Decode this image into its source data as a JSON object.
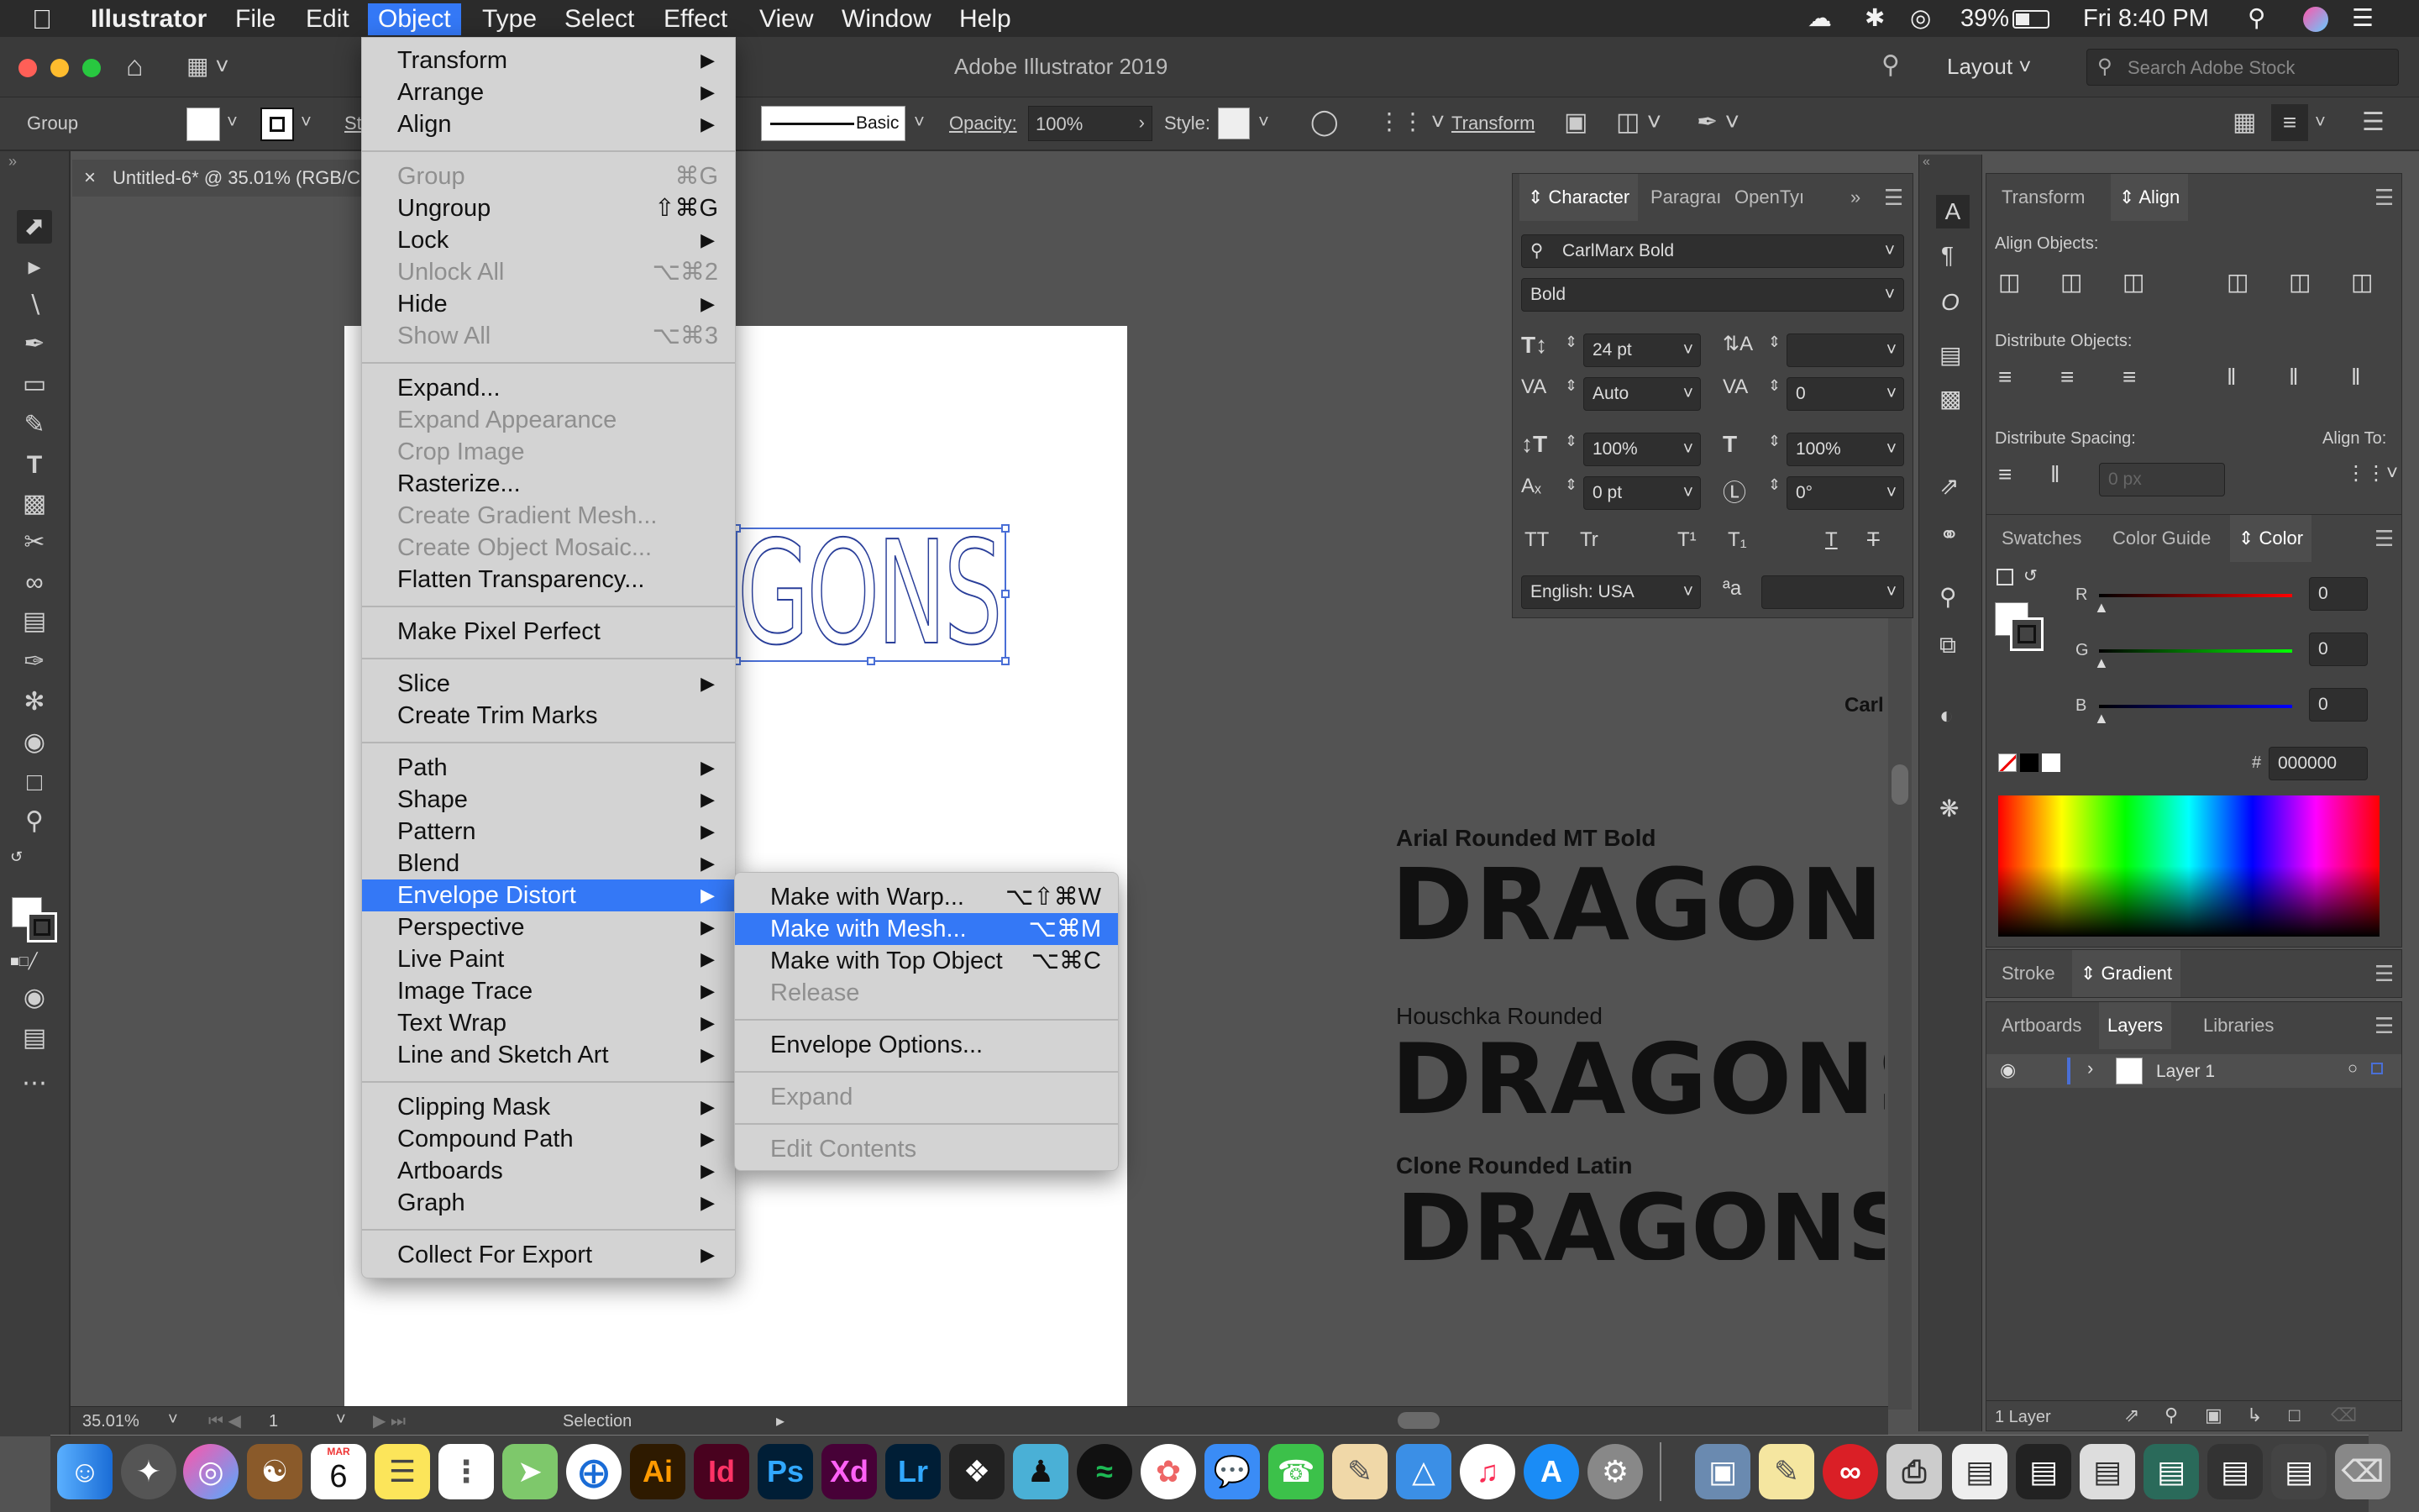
{
  "menubar": {
    "app": "Illustrator",
    "items": [
      "File",
      "Edit",
      "Object",
      "Type",
      "Select",
      "Effect",
      "View",
      "Window",
      "Help"
    ],
    "battery": "39%",
    "clock": "Fri 8:40 PM"
  },
  "titlebar": {
    "title": "Adobe Illustrator 2019",
    "workspace": "Layout",
    "search_placeholder": "Search Adobe Stock"
  },
  "controlbar": {
    "selection": "Group",
    "stroke_label": "St",
    "brush": "Basic",
    "opacity_label": "Opacity:",
    "opacity_value": "100%",
    "style_label": "Style:",
    "transform_label": "Transform"
  },
  "document": {
    "tab_title": "Untitled-6* @ 35.01% (RGB/C",
    "zoom": "35.01%",
    "artboard_num": "1",
    "status": "Selection"
  },
  "object_menu": {
    "items": [
      {
        "label": "Transform",
        "submenu": true
      },
      {
        "label": "Arrange",
        "submenu": true
      },
      {
        "label": "Align",
        "submenu": true
      },
      {
        "label": "Group",
        "shortcut": "⌘G",
        "disabled": true
      },
      {
        "label": "Ungroup",
        "shortcut": "⇧⌘G"
      },
      {
        "label": "Lock",
        "submenu": true
      },
      {
        "label": "Unlock All",
        "shortcut": "⌥⌘2",
        "disabled": true
      },
      {
        "label": "Hide",
        "submenu": true
      },
      {
        "label": "Show All",
        "shortcut": "⌥⌘3",
        "disabled": true
      },
      {
        "label": "Expand..."
      },
      {
        "label": "Expand Appearance",
        "disabled": true
      },
      {
        "label": "Crop Image",
        "disabled": true
      },
      {
        "label": "Rasterize..."
      },
      {
        "label": "Create Gradient Mesh...",
        "disabled": true
      },
      {
        "label": "Create Object Mosaic...",
        "disabled": true
      },
      {
        "label": "Flatten Transparency..."
      },
      {
        "label": "Make Pixel Perfect"
      },
      {
        "label": "Slice",
        "submenu": true
      },
      {
        "label": "Create Trim Marks"
      },
      {
        "label": "Path",
        "submenu": true
      },
      {
        "label": "Shape",
        "submenu": true
      },
      {
        "label": "Pattern",
        "submenu": true
      },
      {
        "label": "Blend",
        "submenu": true
      },
      {
        "label": "Envelope Distort",
        "submenu": true,
        "highlight": true
      },
      {
        "label": "Perspective",
        "submenu": true
      },
      {
        "label": "Live Paint",
        "submenu": true
      },
      {
        "label": "Image Trace",
        "submenu": true
      },
      {
        "label": "Text Wrap",
        "submenu": true
      },
      {
        "label": "Line and Sketch Art",
        "submenu": true
      },
      {
        "label": "Clipping Mask",
        "submenu": true
      },
      {
        "label": "Compound Path",
        "submenu": true
      },
      {
        "label": "Artboards",
        "submenu": true
      },
      {
        "label": "Graph",
        "submenu": true
      },
      {
        "label": "Collect For Export",
        "submenu": true
      }
    ]
  },
  "envelope_menu": {
    "items": [
      {
        "label": "Make with Warp...",
        "shortcut": "⌥⇧⌘W"
      },
      {
        "label": "Make with Mesh...",
        "shortcut": "⌥⌘M",
        "highlight": true
      },
      {
        "label": "Make with Top Object",
        "shortcut": "⌥⌘C"
      },
      {
        "label": "Release",
        "disabled": true
      },
      {
        "label": "Envelope Options..."
      },
      {
        "label": "Expand",
        "disabled": true
      },
      {
        "label": "Edit Contents",
        "disabled": true
      }
    ]
  },
  "canvas": {
    "selected_text": "GONS",
    "clipped_label": "CarlM",
    "samples": [
      {
        "font": "Arial Rounded MT Bold",
        "word": "DRAGONS"
      },
      {
        "font": "Houschka Rounded",
        "word": "DRAGONS"
      },
      {
        "font": "Clone Rounded Latin",
        "word": "DRAGONS"
      }
    ]
  },
  "character_panel": {
    "tabs": [
      "Character",
      "Paragraı",
      "OpenTyı"
    ],
    "font_family": "CarlMarx Bold",
    "font_style": "Bold",
    "size": "24 pt",
    "leading": "",
    "kerning": "Auto",
    "tracking": "0",
    "vscale": "100%",
    "hscale": "100%",
    "baseline": "0 pt",
    "rotation": "0°",
    "language": "English: USA"
  },
  "align_panel": {
    "tabs": [
      "Transform",
      "Align"
    ],
    "align_objects": "Align Objects:",
    "distribute_objects": "Distribute Objects:",
    "distribute_spacing": "Distribute Spacing:",
    "spacing_value": "0 px",
    "align_to": "Align To:"
  },
  "color_panel": {
    "tabs": [
      "Swatches",
      "Color Guide",
      "Color"
    ],
    "r_label": "R",
    "g_label": "G",
    "b_label": "B",
    "r": "0",
    "g": "0",
    "b": "0",
    "hash": "#",
    "hex": "000000"
  },
  "stroke_panel": {
    "tabs": [
      "Stroke",
      "Gradient"
    ]
  },
  "layers_panel": {
    "tabs": [
      "Artboards",
      "Layers",
      "Libraries"
    ],
    "layer_name": "Layer 1",
    "footer": "1 Layer"
  },
  "dock": {
    "calendar_month": "MAR",
    "calendar_day": "6",
    "apps": [
      "Ai",
      "Id",
      "Ps",
      "Xd",
      "Lr"
    ]
  },
  "colors": {
    "menu_highlight": "#3478f6",
    "illustrator": "#ff9a00",
    "indesign": "#ff3366",
    "photoshop": "#31a8ff",
    "xd": "#ff61f6",
    "lightroom": "#31a8ff"
  }
}
